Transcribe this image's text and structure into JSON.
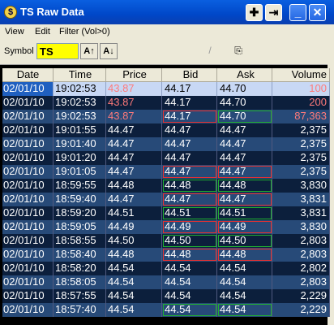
{
  "window": {
    "title": "TS Raw Data",
    "icon": "dollar-icon"
  },
  "titlebar_buttons": [
    {
      "name": "move-button",
      "glyph": "✚"
    },
    {
      "name": "pin-button",
      "glyph": "⇥"
    },
    {
      "name": "minimize-button",
      "glyph": "_"
    },
    {
      "name": "close-button",
      "glyph": "✕"
    }
  ],
  "menu": {
    "view": "View",
    "edit": "Edit",
    "filter": "Filter (Vol>0)"
  },
  "toolbar": {
    "symbol_label": "Symbol",
    "symbol_value": "TS",
    "sort_asc": "A↑",
    "sort_desc": "A↓",
    "tool_glyph": "/",
    "copy_glyph": "⎘"
  },
  "columns": [
    "Date",
    "Time",
    "Price",
    "Bid",
    "Ask",
    "Volume"
  ],
  "colors": {
    "row_odd": "#274a78",
    "row_even": "#0c1f3c",
    "selected": "#c8d8f4",
    "up": "#20b030",
    "down": "#e83030",
    "highlight_text": "#ff7a7a"
  },
  "rows": [
    {
      "date": "02/01/10",
      "time": "19:02:53",
      "price": "43.87",
      "bid": "44.17",
      "ask": "44.70",
      "volume": "100",
      "selected": true,
      "price_pink": true,
      "vol_pink": true
    },
    {
      "date": "02/01/10",
      "time": "19:02:53",
      "price": "43.87",
      "bid": "44.17",
      "ask": "44.70",
      "volume": "200",
      "price_pink": true,
      "vol_pink": true
    },
    {
      "date": "02/01/10",
      "time": "19:02:53",
      "price": "43.87",
      "bid": "44.17",
      "ask": "44.70",
      "volume": "87,363",
      "price_pink": true,
      "vol_pink": true,
      "bid_box": "red",
      "ask_box": "green"
    },
    {
      "date": "02/01/10",
      "time": "19:01:55",
      "price": "44.47",
      "bid": "44.47",
      "ask": "44.47",
      "volume": "2,375"
    },
    {
      "date": "02/01/10",
      "time": "19:01:40",
      "price": "44.47",
      "bid": "44.47",
      "ask": "44.47",
      "volume": "2,375"
    },
    {
      "date": "02/01/10",
      "time": "19:01:20",
      "price": "44.47",
      "bid": "44.47",
      "ask": "44.47",
      "volume": "2,375"
    },
    {
      "date": "02/01/10",
      "time": "19:01:05",
      "price": "44.47",
      "bid": "44.47",
      "ask": "44.47",
      "volume": "2,375",
      "bid_box": "red",
      "ask_box": "red"
    },
    {
      "date": "02/01/10",
      "time": "18:59:55",
      "price": "44.48",
      "bid": "44.48",
      "ask": "44.48",
      "volume": "3,830",
      "bid_box": "green",
      "ask_box": "green"
    },
    {
      "date": "02/01/10",
      "time": "18:59:40",
      "price": "44.47",
      "bid": "44.47",
      "ask": "44.47",
      "volume": "3,831",
      "bid_box": "red",
      "ask_box": "red"
    },
    {
      "date": "02/01/10",
      "time": "18:59:20",
      "price": "44.51",
      "bid": "44.51",
      "ask": "44.51",
      "volume": "3,831",
      "bid_box": "green",
      "ask_box": "green"
    },
    {
      "date": "02/01/10",
      "time": "18:59:05",
      "price": "44.49",
      "bid": "44.49",
      "ask": "44.49",
      "volume": "3,830",
      "bid_box": "red",
      "ask_box": "red"
    },
    {
      "date": "02/01/10",
      "time": "18:58:55",
      "price": "44.50",
      "bid": "44.50",
      "ask": "44.50",
      "volume": "2,803",
      "bid_box": "green",
      "ask_box": "green"
    },
    {
      "date": "02/01/10",
      "time": "18:58:40",
      "price": "44.48",
      "bid": "44.48",
      "ask": "44.48",
      "volume": "2,803",
      "bid_box": "red",
      "ask_box": "red"
    },
    {
      "date": "02/01/10",
      "time": "18:58:20",
      "price": "44.54",
      "bid": "44.54",
      "ask": "44.54",
      "volume": "2,802"
    },
    {
      "date": "02/01/10",
      "time": "18:58:05",
      "price": "44.54",
      "bid": "44.54",
      "ask": "44.54",
      "volume": "2,803"
    },
    {
      "date": "02/01/10",
      "time": "18:57:55",
      "price": "44.54",
      "bid": "44.54",
      "ask": "44.54",
      "volume": "2,229"
    },
    {
      "date": "02/01/10",
      "time": "18:57:40",
      "price": "44.54",
      "bid": "44.54",
      "ask": "44.54",
      "volume": "2,229",
      "bid_box": "green",
      "ask_box": "green"
    }
  ]
}
